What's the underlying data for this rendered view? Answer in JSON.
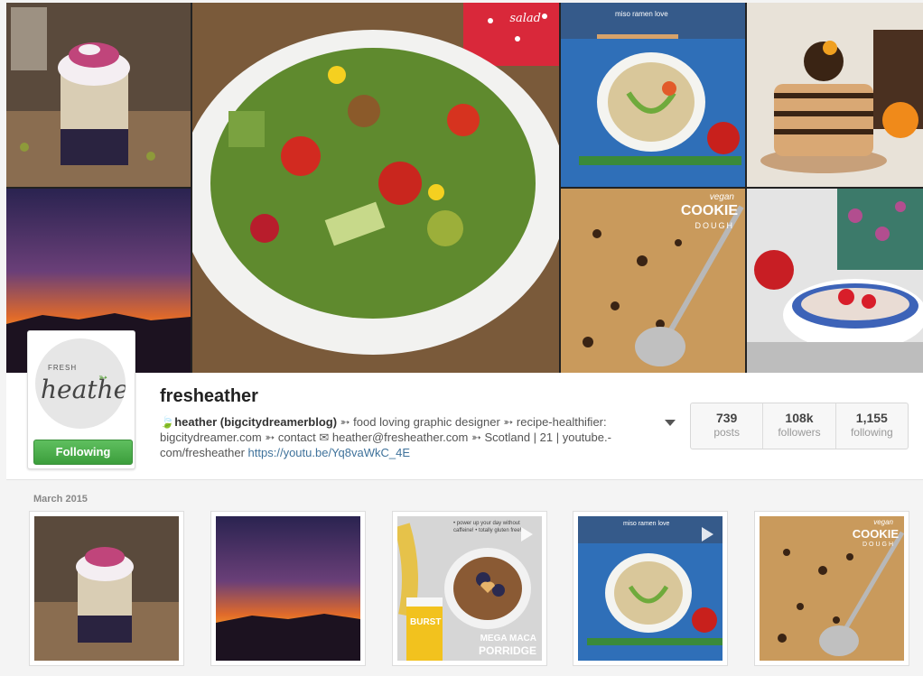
{
  "profile": {
    "username": "fresheather",
    "follow_label": "Following",
    "avatar_text_top": "FRESH",
    "avatar_text_main": "heather",
    "bio_emoji": "🍃",
    "bio_name": "heather (bigcitydreamerblog)",
    "bio_text": " ➳ food loving graphic designer ➳ recipe-healthifier: bigcitydreamer.com ➳ contact ✉ heather@fresheather.com ➳ Scotland | 21 | youtube.-com/fresheather ",
    "bio_link": "https://youtu.be/Yq8vaWkC_4E"
  },
  "stats": [
    {
      "value": "739",
      "label": "posts"
    },
    {
      "value": "108k",
      "label": "followers"
    },
    {
      "value": "1,155",
      "label": "following"
    }
  ],
  "hero": {
    "salad_label": "salad",
    "ramen_label": "miso ramen love",
    "cookie_label_1": "vegan",
    "cookie_label_2": "COOKIE",
    "cookie_label_3": "DOUGH"
  },
  "feed": {
    "month": "March 2015",
    "porridge_top": "• power up your day without caffeine! • totally gluten free!",
    "porridge_label_1": "MEGA MACA",
    "porridge_label_2": "PORRIDGE",
    "porridge_brand": "BURST",
    "thumb_ramen_label": "miso ramen love",
    "thumb_cookie_label_1": "vegan",
    "thumb_cookie_label_2": "COOKIE",
    "thumb_cookie_label_3": "DOUGH"
  },
  "colors": {
    "accent_link": "#3f729b",
    "follow_green": "#4cae4c",
    "sunset_orange": "#e8581c"
  }
}
